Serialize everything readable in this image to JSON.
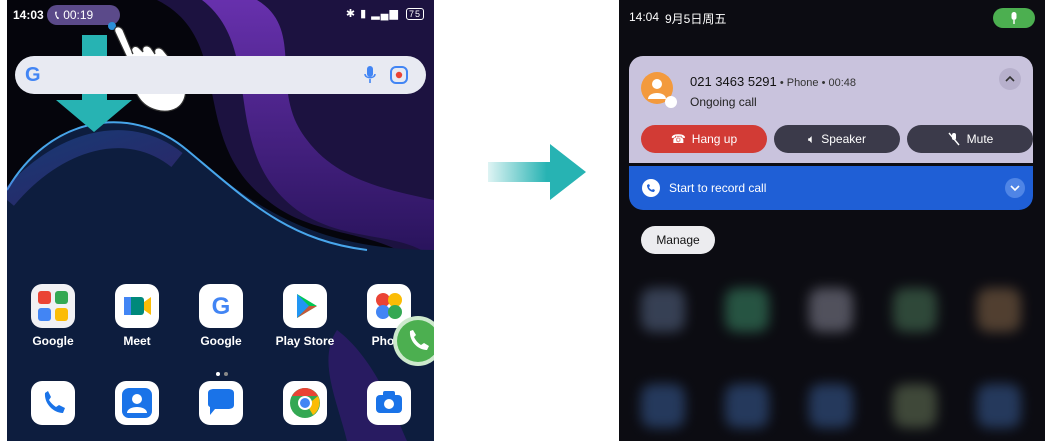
{
  "left_screen": {
    "status": {
      "time": "14:03",
      "call_timer": "00:19",
      "battery": "75"
    },
    "search": {
      "logo": "G",
      "mic_icon": "mic-icon",
      "lens_icon": "lens-icon"
    },
    "apps_row1": [
      {
        "label": "Google",
        "icon": "folder-icon"
      },
      {
        "label": "Meet",
        "icon": "meet-icon"
      },
      {
        "label": "Google",
        "icon": "google-icon"
      },
      {
        "label": "Play Store",
        "icon": "play-store-icon"
      },
      {
        "label": "Phot",
        "icon": "photos-icon"
      }
    ],
    "dock": [
      {
        "icon": "phone-icon"
      },
      {
        "icon": "contacts-icon"
      },
      {
        "icon": "messages-icon"
      },
      {
        "icon": "chrome-icon"
      },
      {
        "icon": "camera-icon"
      }
    ]
  },
  "right_screen": {
    "status": {
      "time": "14:04",
      "date": "9月5日周五"
    },
    "notification": {
      "number": "021 3463 5291",
      "meta": " • Phone • 00:48",
      "status": "Ongoing call",
      "buttons": {
        "hang_up": "Hang up",
        "speaker": "Speaker",
        "mute": "Mute"
      }
    },
    "record": {
      "label": "Start to record call"
    },
    "manage": "Manage"
  },
  "colors": {
    "hang_up": "#d23b35",
    "record_bar": "#1f5fd6",
    "call_green": "#4caf50",
    "arrow": "#27b3b3"
  }
}
